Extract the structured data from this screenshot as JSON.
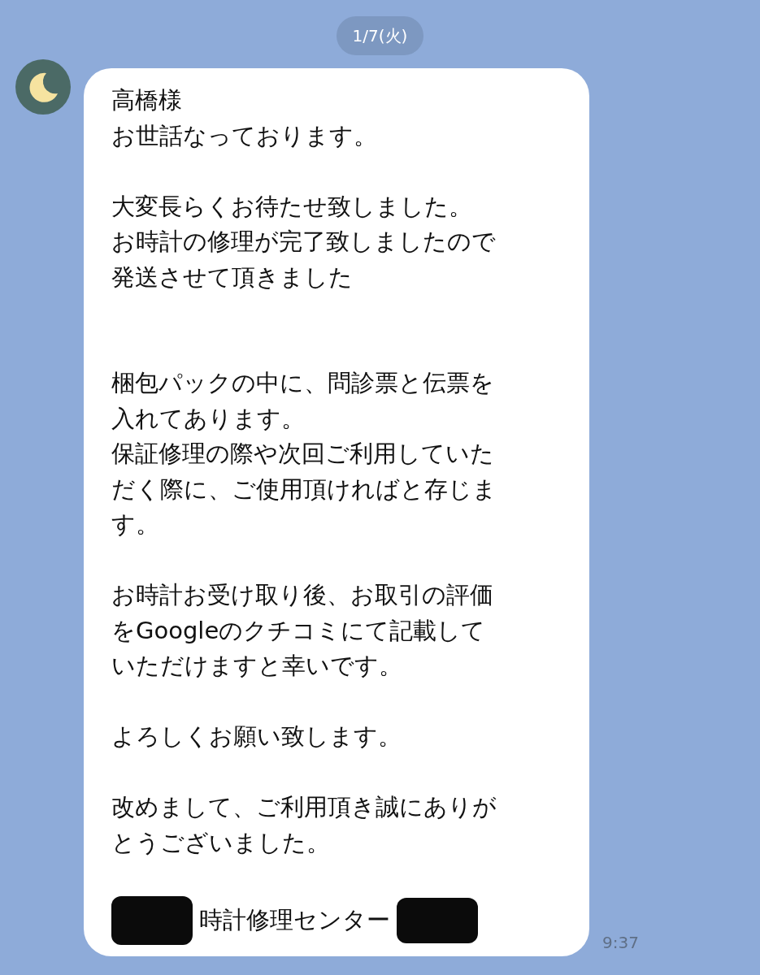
{
  "date_separator": "1/7(火)",
  "message": {
    "sender_avatar": {
      "kind": "moon"
    },
    "paragraphs": [
      {
        "lines": [
          "高橋様",
          "お世話なっております。"
        ],
        "extra_space_after": false
      },
      {
        "lines": [
          "大変長らくお待たせ致しました。",
          "お時計の修理が完了致しましたので",
          "発送させて頂きました"
        ],
        "extra_space_after": true
      },
      {
        "lines": [
          "梱包パックの中に、問診票と伝票を",
          "入れてあります。",
          "保証修理の際や次回ご利用していた",
          "だく際に、ご使用頂ければと存じま",
          "す。"
        ],
        "extra_space_after": false
      },
      {
        "lines": [
          "お時計お受け取り後、お取引の評価",
          "をGoogleのクチコミにて記載して",
          "いただけますと幸いです。"
        ],
        "extra_space_after": false
      },
      {
        "lines": [
          "よろしくお願い致します。"
        ],
        "extra_space_after": false
      },
      {
        "lines": [
          "改めまして、ご利用頂き誠にありが",
          "とうございました。"
        ],
        "extra_space_after": false
      },
      {
        "lines": [
          "時計修理センター"
        ],
        "redacted_before": true,
        "redacted_after": true
      }
    ],
    "time": "9:37"
  }
}
